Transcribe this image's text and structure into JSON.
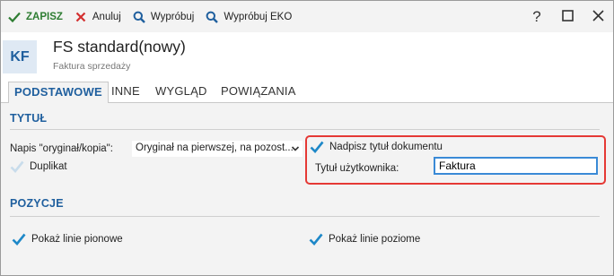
{
  "toolbar": {
    "save_label": "ZAPISZ",
    "cancel_label": "Anuluj",
    "try_label": "Wypróbuj",
    "try_eko_label": "Wypróbuj EKO",
    "help_label": "?"
  },
  "header": {
    "badge": "KF",
    "title": "FS standard(nowy)",
    "subtitle": "Faktura sprzedaży"
  },
  "tabs": [
    {
      "label": "PODSTAWOWE"
    },
    {
      "label": "INNE"
    },
    {
      "label": "WYGLĄD"
    },
    {
      "label": "POWIĄZANIA"
    }
  ],
  "sections": {
    "title_section": "TYTUŁ",
    "positions_section": "POZYCJE"
  },
  "form": {
    "copy_label": "Napis \"oryginał/kopia\":",
    "copy_value": "Oryginał na pierwszej, na pozost...",
    "duplicate_label": "Duplikat",
    "duplicate_checked": true,
    "override_title_label": "Nadpisz tytuł dokumentu",
    "override_title_checked": true,
    "user_title_label": "Tytuł użytkownika:",
    "user_title_value": "Faktura",
    "vertical_lines_label": "Pokaż linie pionowe",
    "vertical_lines_checked": true,
    "horizontal_lines_label": "Pokaż linie poziome",
    "horizontal_lines_checked": true
  },
  "colors": {
    "accent": "#1f5f9e",
    "check": "#1e88c8",
    "save_green": "#2e7d32",
    "cancel_red": "#d32f2f",
    "highlight_red": "#e53935"
  }
}
